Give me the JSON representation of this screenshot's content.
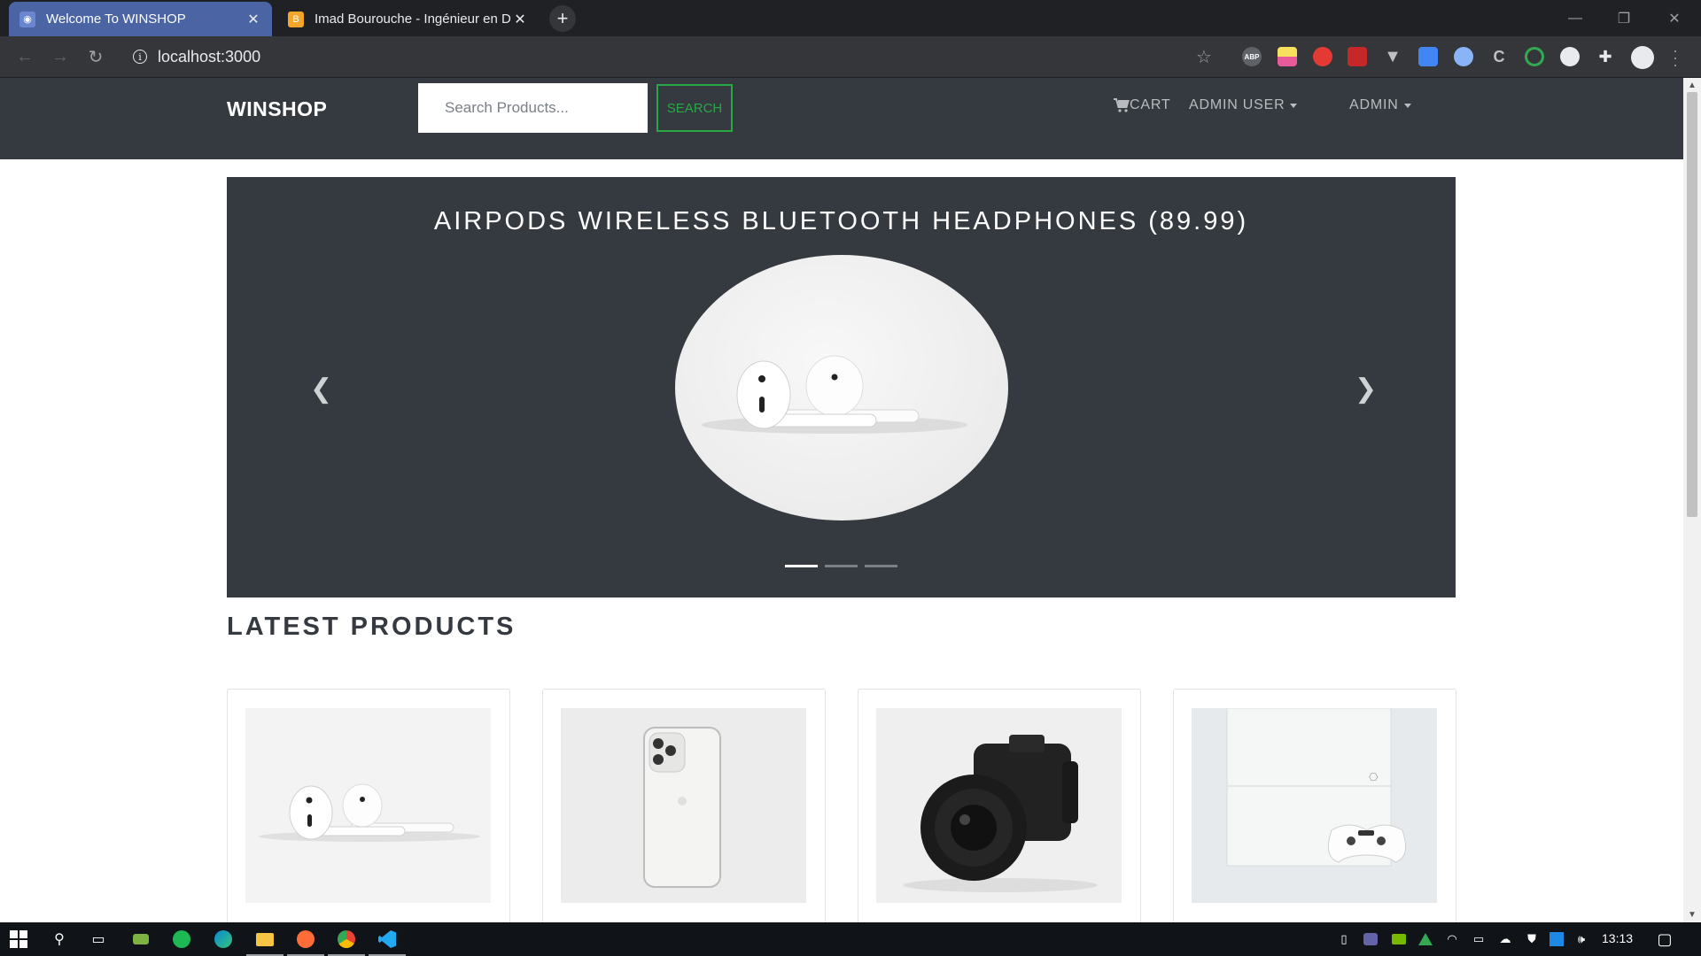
{
  "browser": {
    "tabs": [
      {
        "title": "Welcome To WINSHOP",
        "active": true
      },
      {
        "title": "Imad Bourouche - Ingénieur en D",
        "active": false
      }
    ],
    "url": "localhost:3000",
    "extensions": [
      "abp-icon",
      "notes-icon",
      "hand-icon",
      "puzzle-game-icon",
      "vuejs-icon",
      "translate-icon",
      "vpn-icon",
      "colorzilla-icon",
      "target-icon",
      "moon-icon",
      "extensions-icon"
    ]
  },
  "navbar": {
    "brand": "WINSHOP",
    "search_placeholder": "Search Products...",
    "search_button": "SEARCH",
    "cart_label": "CART",
    "user_menu": "ADMIN USER",
    "admin_menu": "ADMIN"
  },
  "carousel": {
    "title": "AIRPODS WIRELESS BLUETOOTH HEADPHONES (89.99)",
    "slide_count": 3,
    "active_slide": 1
  },
  "latest": {
    "heading": "LATEST PRODUCTS",
    "products": [
      {
        "image": "airpods"
      },
      {
        "image": "iphone"
      },
      {
        "image": "camera"
      },
      {
        "image": "playstation"
      }
    ]
  },
  "taskbar": {
    "time": "13:13"
  },
  "colors": {
    "navbar_bg": "#343a40",
    "success": "#28a745",
    "tab_active": "#4a64a4"
  }
}
